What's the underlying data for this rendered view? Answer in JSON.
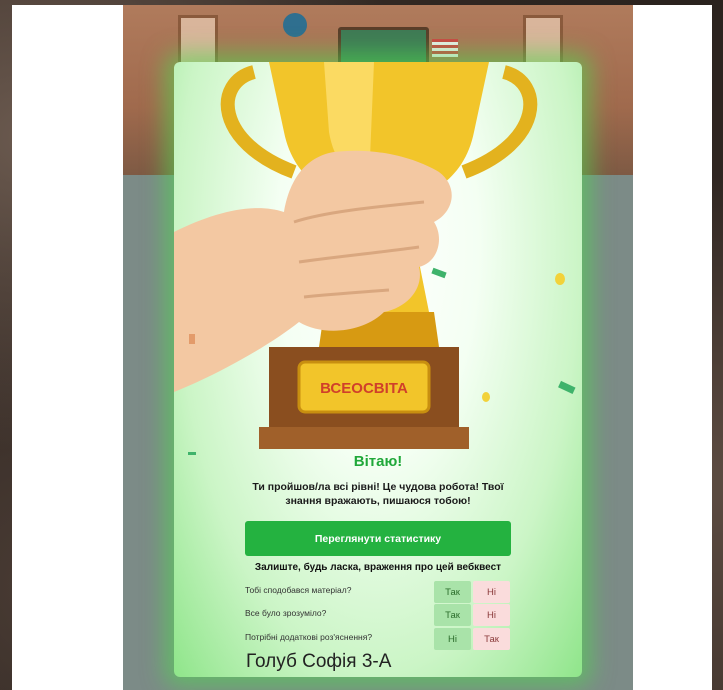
{
  "popup": {
    "plaque_text": "ВСЕОСВІТА",
    "title": "Вітаю!",
    "message": "Ти пройшов/ла всі рівні! Це чудова робота! Твої знання вражають, пишаюся тобою!",
    "stats_button": "Переглянути статистику",
    "feedback_title": "Залиште, будь ласка, враження про цей вебквест",
    "questions": [
      {
        "text": "Тобі сподобався матеріал?",
        "left": "Так",
        "right": "Ні",
        "left_color": "green",
        "right_color": "pink"
      },
      {
        "text": "Все було зрозуміло?",
        "left": "Так",
        "right": "Ні",
        "left_color": "green",
        "right_color": "pink"
      },
      {
        "text": "Потрібні додаткові роз'яснення?",
        "left": "Ні",
        "right": "Так",
        "left_color": "green",
        "right_color": "pink"
      }
    ],
    "signature": "Голуб Софія 3-А"
  },
  "colors": {
    "accent_green": "#24b240",
    "title_green": "#20a83a",
    "yes_green": "#a9e3a9",
    "no_pink": "#fadcdc"
  },
  "icons": [
    "trophy-illustration",
    "globe-icon",
    "flag-icon"
  ]
}
